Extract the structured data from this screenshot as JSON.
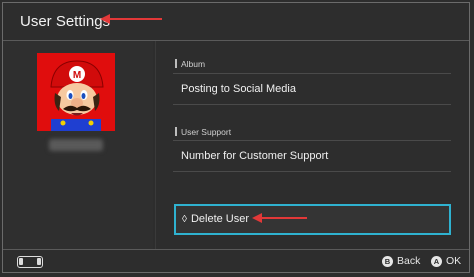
{
  "header": {
    "title": "User Settings"
  },
  "sidebar": {
    "avatar_icon": "mario-avatar",
    "username": ""
  },
  "sections": [
    {
      "label": "Album",
      "item": "Posting to Social Media"
    },
    {
      "label": "User Support",
      "item": "Number for Customer Support"
    }
  ],
  "delete": {
    "label": "Delete User",
    "icon": "diamond-icon"
  },
  "footer": {
    "back_button": "B",
    "back_label": "Back",
    "ok_button": "A",
    "ok_label": "OK"
  },
  "colors": {
    "background": "#2d2d2d",
    "highlight": "#2fb2d0",
    "annotation_arrow": "#e23838",
    "avatar_bg": "#e00d0d"
  }
}
